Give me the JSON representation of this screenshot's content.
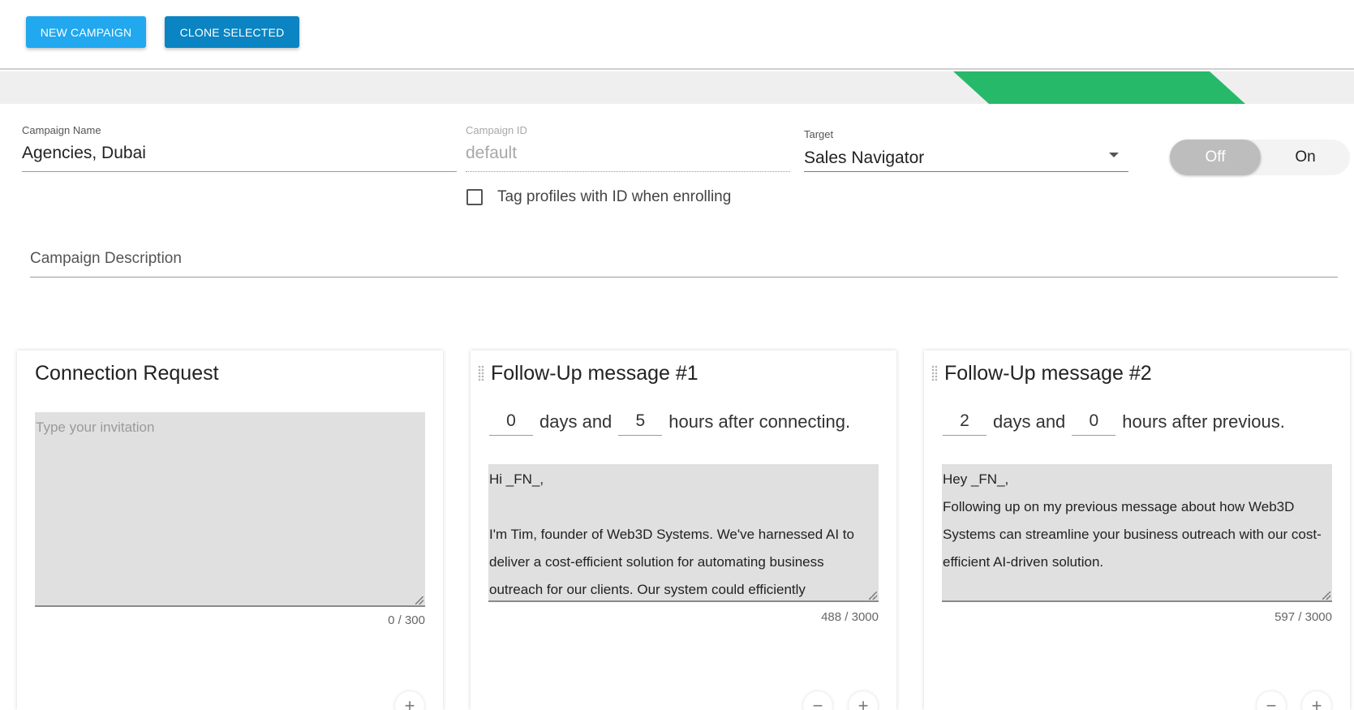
{
  "toolbar": {
    "new_campaign": "NEW CAMPAIGN",
    "clone_selected": "CLONE SELECTED"
  },
  "progress": {
    "fill_color": "#27b96a",
    "track_color": "#efefef"
  },
  "form": {
    "campaign_name": {
      "label": "Campaign Name",
      "value": "Agencies, Dubai"
    },
    "campaign_id": {
      "label": "Campaign ID",
      "value": "default"
    },
    "target": {
      "label": "Target",
      "value": "Sales Navigator"
    },
    "toggle": {
      "off_label": "Off",
      "on_label": "On",
      "state": "off"
    },
    "tag_checkbox": {
      "label": "Tag profiles with ID when enrolling",
      "checked": false
    },
    "description": {
      "placeholder": "Campaign Description"
    }
  },
  "cards": [
    {
      "title": "Connection Request",
      "placeholder": "Type your invitation",
      "message": "",
      "counter": "0 / 300"
    },
    {
      "title": "Follow-Up message #1",
      "days": "0",
      "days_label": "days and",
      "hours": "5",
      "hours_label": "hours after connecting.",
      "message": "Hi _FN_,\n\nI'm Tim, founder of Web3D Systems. We've harnessed AI to deliver a cost-efficient solution for automating business outreach for our clients. Our system could efficiently",
      "counter": "488 / 3000",
      "minus": "−",
      "plus": "+"
    },
    {
      "title": "Follow-Up message #2",
      "days": "2",
      "days_label": "days and",
      "hours": "0",
      "hours_label": "hours after previous.",
      "message": "Hey _FN_,\nFollowing up on my previous message about how Web3D Systems can streamline your business outreach with our cost-efficient AI-driven solution.",
      "counter": "597 / 3000",
      "minus": "−",
      "plus": "+"
    }
  ],
  "card0_plus": "+"
}
